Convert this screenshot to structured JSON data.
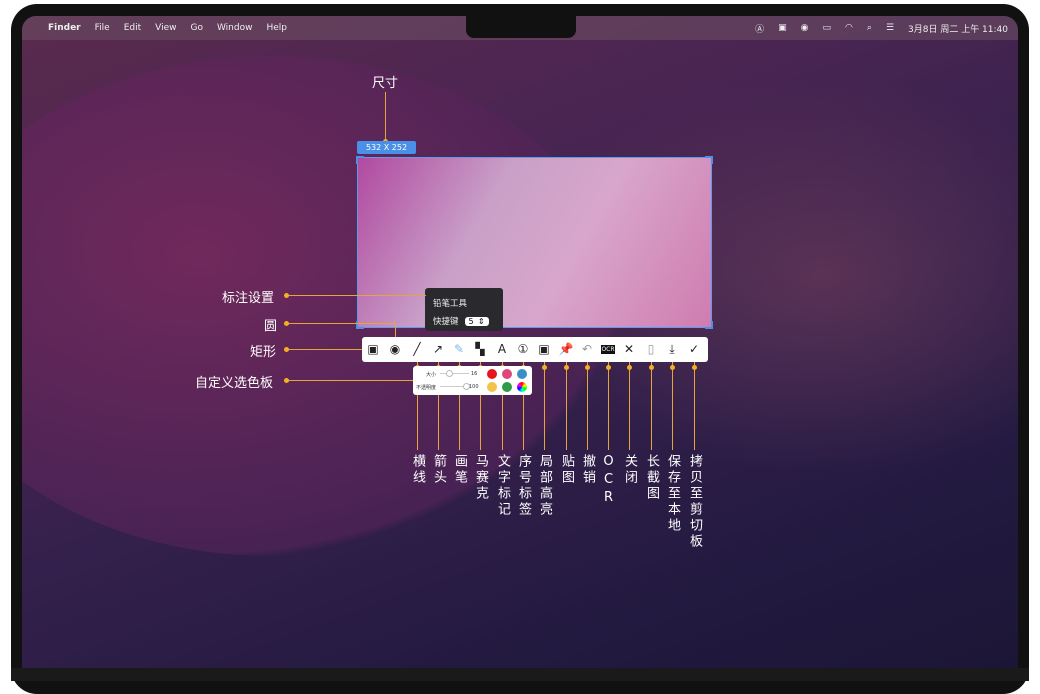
{
  "menubar": {
    "apple": "",
    "app": "Finder",
    "items": [
      "File",
      "Edit",
      "View",
      "Go",
      "Window",
      "Help"
    ],
    "clock": "3月8日 周二 上午 11:40",
    "status_icons": [
      "input-A-icon",
      "image-icon",
      "play-icon",
      "battery-icon",
      "wifi-icon",
      "search-icon",
      "control-center-icon"
    ]
  },
  "size_label": "尺寸",
  "size_badge": "532  X  252",
  "tooltip": {
    "title": "铅笔工具",
    "shortcut_label": "快捷键",
    "shortcut_value": "5"
  },
  "palette": {
    "size_label": "大小",
    "size_value": "16",
    "opacity_label": "不透明度",
    "opacity_value": "100",
    "size_fraction": 0.3,
    "opacity_fraction": 1.0,
    "colors": [
      "#e8141c",
      "#e0457e",
      "#3a8fc8",
      "#f2c24c",
      "#2f9a48",
      "rainbow"
    ]
  },
  "left_labels": {
    "annotation_settings": "标注设置",
    "circle": "圆",
    "rectangle": "矩形",
    "custom_palette": "自定义选色板"
  },
  "tools": [
    {
      "icon": "rectangle-icon",
      "glyph": "▣"
    },
    {
      "icon": "circle-icon",
      "glyph": "◉"
    },
    {
      "icon": "line-icon",
      "glyph": "╱",
      "label": "横线"
    },
    {
      "icon": "arrow-icon",
      "glyph": "↗",
      "label": "箭头"
    },
    {
      "icon": "pencil-icon",
      "glyph": "✎",
      "label": "画笔"
    },
    {
      "icon": "mosaic-icon",
      "glyph": "▚",
      "label": "马赛克"
    },
    {
      "icon": "text-icon",
      "glyph": "A",
      "label": "文字标记"
    },
    {
      "icon": "number-icon",
      "glyph": "①",
      "label": "序号标签"
    },
    {
      "icon": "highlight-icon",
      "glyph": "▣",
      "label": "局部高亮"
    },
    {
      "icon": "pin-icon",
      "glyph": "📌",
      "label": "贴图"
    },
    {
      "icon": "undo-icon",
      "glyph": "↶",
      "label": "撤销"
    },
    {
      "icon": "ocr-icon",
      "glyph": "OCR",
      "label": "OCR"
    },
    {
      "icon": "close-icon",
      "glyph": "✕",
      "label": "关闭"
    },
    {
      "icon": "long-screenshot-icon",
      "glyph": "▯",
      "label": "长截图"
    },
    {
      "icon": "download-icon",
      "glyph": "⤓",
      "label": "保存至本地"
    },
    {
      "icon": "check-icon",
      "glyph": "✓",
      "label": "拷贝至剪切板"
    }
  ]
}
